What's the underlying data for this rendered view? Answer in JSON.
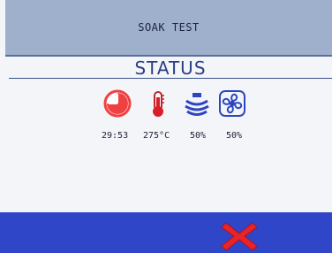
{
  "header": {
    "title": "SOAK TEST"
  },
  "status": {
    "heading": "STATUS",
    "items": [
      {
        "icon": "timer-icon",
        "value": "29:53"
      },
      {
        "icon": "thermometer-icon",
        "value": "275°C"
      },
      {
        "icon": "steam-icon",
        "value": "50%"
      },
      {
        "icon": "fan-icon",
        "value": "50%"
      }
    ]
  },
  "footer": {
    "cancel_icon": "close-icon"
  },
  "colors": {
    "accent": "#2c3f86",
    "header_bg": "#9fb0cc",
    "footer_bg": "#2f46c8",
    "cancel": "#e8242a",
    "timer": "#ef4141"
  }
}
